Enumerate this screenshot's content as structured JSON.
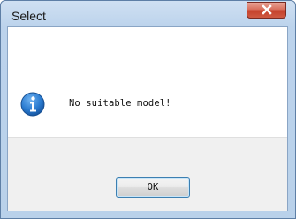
{
  "window": {
    "title": "Select"
  },
  "dialog": {
    "message": "No suitable model!",
    "icon": "information-icon",
    "ok_label": "OK"
  },
  "titlebar": {
    "close_icon": "close-icon"
  },
  "colors": {
    "titlebar": "#b9d1ea",
    "close_button": "#c5412c",
    "info_icon": "#1f6fc6",
    "footer": "#f0f0f0",
    "ok_border": "#3c7fb1"
  }
}
